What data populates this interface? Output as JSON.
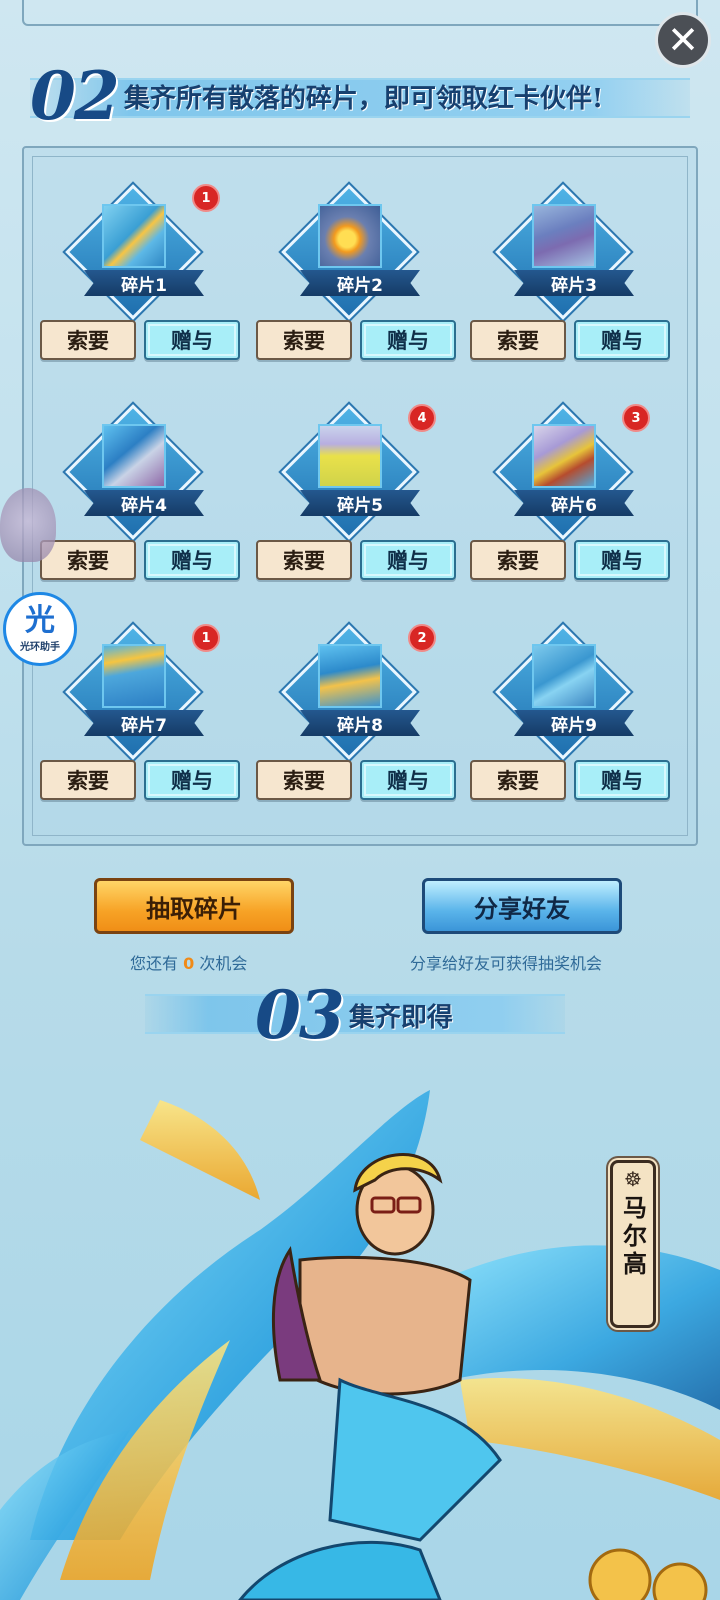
{
  "header": {
    "close_label": "✕"
  },
  "section02": {
    "number": "02",
    "title": "集齐所有散落的碎片，即可领取红卡伙伴!"
  },
  "fragments": [
    {
      "label": "碎片1",
      "badge": "1"
    },
    {
      "label": "碎片2",
      "badge": ""
    },
    {
      "label": "碎片3",
      "badge": ""
    },
    {
      "label": "碎片4",
      "badge": ""
    },
    {
      "label": "碎片5",
      "badge": "4"
    },
    {
      "label": "碎片6",
      "badge": "3"
    },
    {
      "label": "碎片7",
      "badge": "1"
    },
    {
      "label": "碎片8",
      "badge": "2"
    },
    {
      "label": "碎片9",
      "badge": ""
    }
  ],
  "buttons": {
    "ask_label": "索要",
    "give_label": "赠与"
  },
  "actions": {
    "draw_label": "抽取碎片",
    "share_label": "分享好友",
    "chances_prefix": "您还有",
    "chances_count": "0",
    "chances_suffix": "次机会",
    "share_hint": "分享给好友可获得抽奖机会"
  },
  "section03": {
    "number": "03",
    "title": "集齐即得"
  },
  "reward": {
    "character_name": "马尔高",
    "wheel_icon": "ship-wheel-icon"
  },
  "assistant": {
    "glyph": "光",
    "caption": "光环助手"
  },
  "colors": {
    "title_blue": "#174a86",
    "badge_red": "#d82624",
    "draw_orange": "#f7a326",
    "share_blue": "#5ab4ea",
    "count_orange": "#f08a17"
  }
}
